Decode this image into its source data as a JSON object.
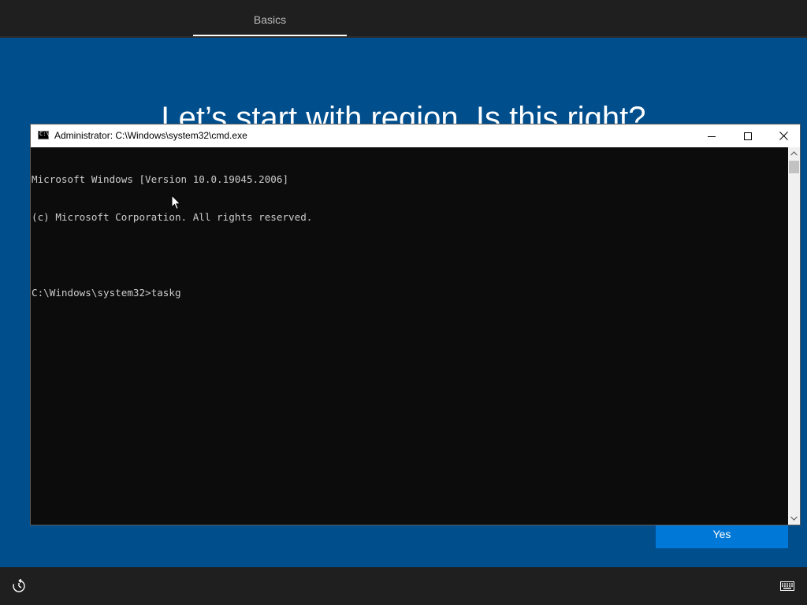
{
  "oobe": {
    "tab_label": "Basics",
    "title": "Let’s start with region. Is this right?",
    "yes_label": "Yes"
  },
  "cmd": {
    "window_title": "Administrator: C:\\Windows\\system32\\cmd.exe",
    "icon_text": "C:\\",
    "lines": [
      "Microsoft Windows [Version 10.0.19045.2006]",
      "(c) Microsoft Corporation. All rights reserved.",
      "",
      "C:\\Windows\\system32>taskg"
    ]
  },
  "icons": {
    "ease_of_access": "ease-of-access-icon",
    "keyboard": "keyboard-icon",
    "minimize": "minimize-icon",
    "maximize": "maximize-icon",
    "close": "close-icon"
  },
  "colors": {
    "background": "#004e8c",
    "accent": "#0078d7",
    "console_bg": "#0c0c0c",
    "console_text": "#cccccc"
  }
}
